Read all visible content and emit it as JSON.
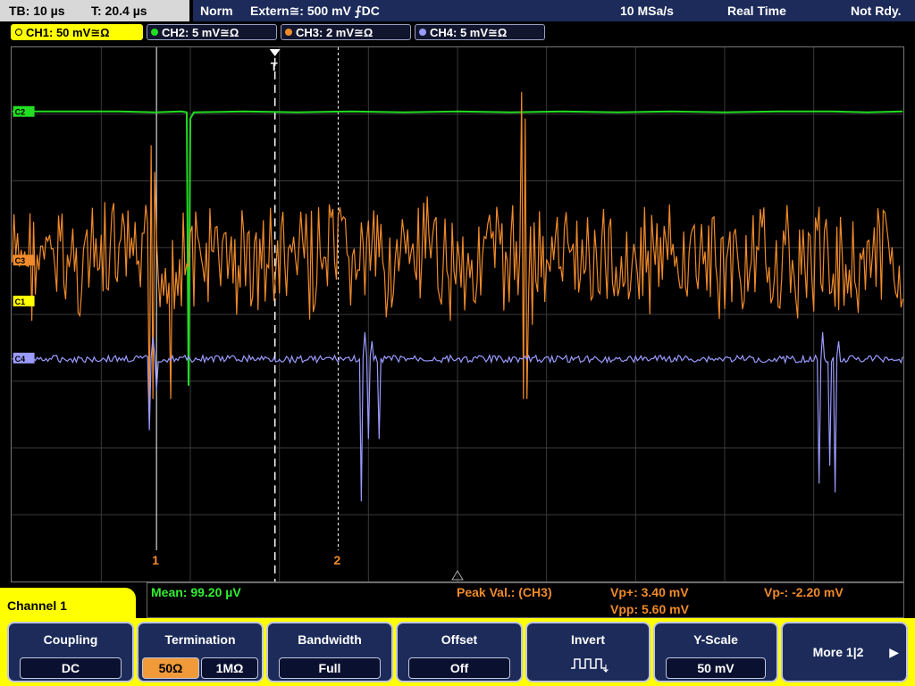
{
  "header": {
    "timebase": "TB: 10 µs",
    "trigger_pos": "T: 20.4 µs",
    "mode": "Norm",
    "trigger": "Extern≅: 500 mV ⨍DC",
    "sample_rate": "10 MSa/s",
    "acq_mode": "Real Time",
    "state": "Not Rdy."
  },
  "channels": [
    {
      "label": "CH1: 50 mV≅Ω",
      "color": "#ffff00",
      "active": true
    },
    {
      "label": "CH2: 5 mV≅Ω",
      "color": "#22dd22",
      "active": false
    },
    {
      "label": "CH3: 2 mV≅Ω",
      "color": "#f08a2a",
      "active": false
    },
    {
      "label": "CH4: 5 mV≅Ω",
      "color": "#9a9aff",
      "active": false
    }
  ],
  "markers": {
    "ch2": "C2",
    "ch3": "C3",
    "ch1": "C1",
    "ch4": "C4",
    "trigger": "T",
    "cursor1": "1",
    "cursor2": "2"
  },
  "measurements": {
    "mean": "Mean: 99.20 µV",
    "peak_label": "Peak Val.: (CH3)",
    "vp_plus": "Vp+: 3.40 mV",
    "vp_minus": "Vp-: -2.20 mV",
    "vpp": "Vpp: 5.60 mV"
  },
  "channel_menu": {
    "title": "Channel 1"
  },
  "softkeys": {
    "coupling": {
      "title": "Coupling",
      "value": "DC"
    },
    "termination": {
      "title": "Termination",
      "opt1": "50Ω",
      "opt2": "1MΩ"
    },
    "bandwidth": {
      "title": "Bandwidth",
      "value": "Full"
    },
    "offset": {
      "title": "Offset",
      "value": "Off"
    },
    "invert": {
      "title": "Invert"
    },
    "yscale": {
      "title": "Y-Scale",
      "value": "50 mV"
    },
    "more": {
      "title": "More 1|2"
    }
  },
  "colors": {
    "ch1": "#ffff00",
    "ch2": "#22dd22",
    "ch3": "#f08a2a",
    "ch4": "#9a9aff",
    "menu": "#1c2b5a",
    "measure_green": "#33ee33",
    "measure_orange": "#f08a2a"
  }
}
